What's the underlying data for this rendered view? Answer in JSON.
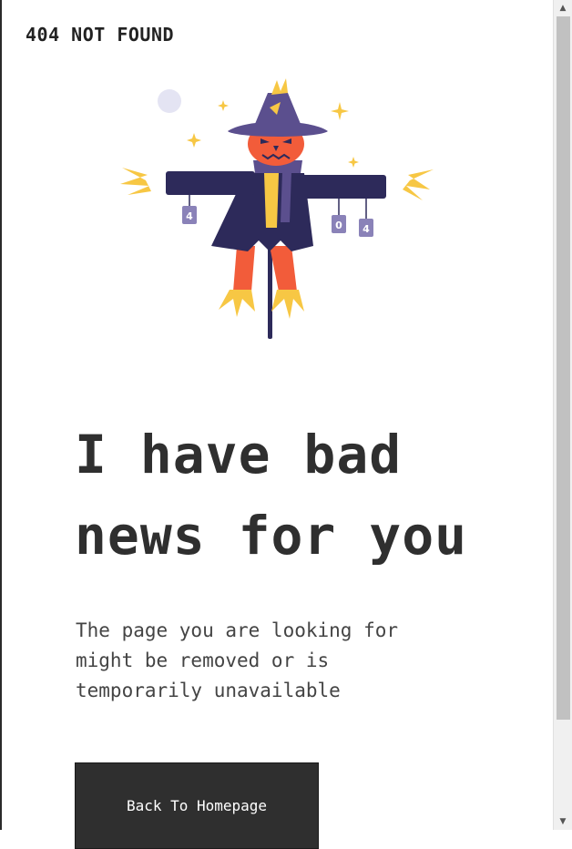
{
  "brand": {
    "text": "404 NOT FOUND"
  },
  "illustration": {
    "tag_left": "4",
    "tag_mid": "0",
    "tag_right": "4"
  },
  "headline": {
    "line1": "I have bad",
    "line2": "news for you"
  },
  "subtext": {
    "line1": "The page you are looking for",
    "line2": "might be removed or is",
    "line3": "temporarily unavailable"
  },
  "button": {
    "label": "Back To Homepage"
  },
  "colors": {
    "coat": "#2d2a5a",
    "hat": "#5b4f8e",
    "face": "#f25c3a",
    "straw": "#f7c744",
    "text": "#2f2f2f",
    "button_bg": "#2f2f2f"
  },
  "icons": {
    "scroll_up": "triangle-up-icon",
    "scroll_down": "triangle-down-icon"
  }
}
